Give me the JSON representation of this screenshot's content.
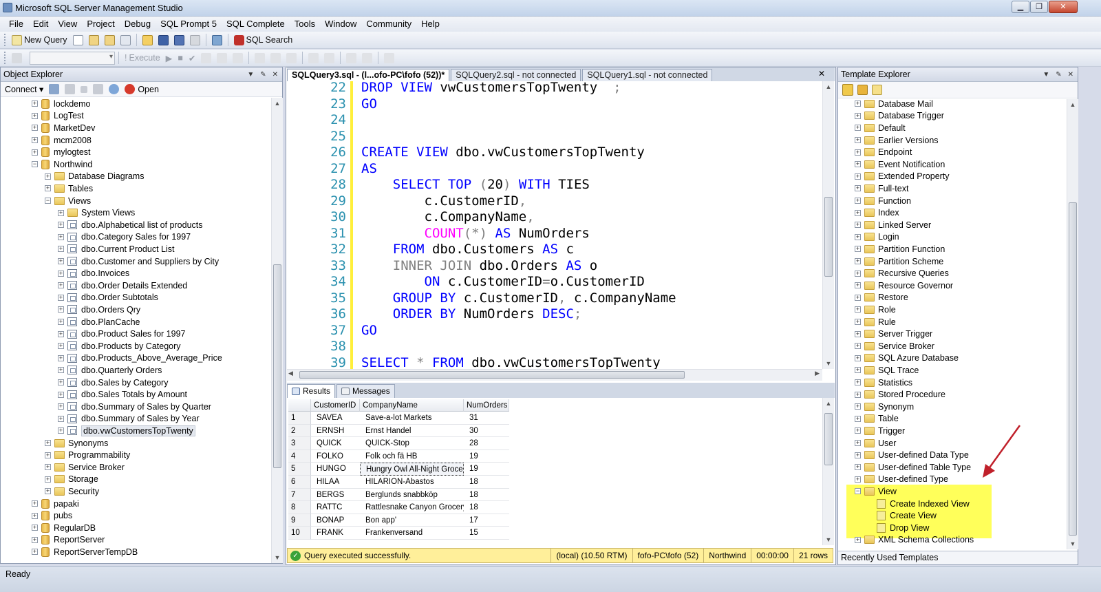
{
  "app": {
    "title": "Microsoft SQL Server Management Studio",
    "status": "Ready"
  },
  "colors": {
    "keyword": "#0000ff",
    "gray_keyword": "#808080",
    "function": "#ff00ff",
    "line_number": "#2b91af",
    "highlight": "#ffff5a",
    "status_bar": "#ffef9a",
    "arrow": "#c0202a"
  },
  "menu": [
    "File",
    "Edit",
    "View",
    "Project",
    "Debug",
    "SQL Prompt 5",
    "SQL Complete",
    "Tools",
    "Window",
    "Community",
    "Help"
  ],
  "toolbar": {
    "new_query": "New Query",
    "sql_search": "SQL Search",
    "execute": "Execute"
  },
  "object_explorer": {
    "title": "Object Explorer",
    "connect": "Connect",
    "open": "Open",
    "nodes": [
      {
        "level": 0,
        "kind": "db",
        "expanded": false,
        "label": "lockdemo"
      },
      {
        "level": 0,
        "kind": "db",
        "expanded": false,
        "label": "LogTest"
      },
      {
        "level": 0,
        "kind": "db",
        "expanded": false,
        "label": "MarketDev"
      },
      {
        "level": 0,
        "kind": "db",
        "expanded": false,
        "label": "mcm2008"
      },
      {
        "level": 0,
        "kind": "db",
        "expanded": false,
        "label": "mylogtest"
      },
      {
        "level": 0,
        "kind": "db",
        "expanded": true,
        "label": "Northwind"
      },
      {
        "level": 1,
        "kind": "folder",
        "expanded": false,
        "label": "Database Diagrams"
      },
      {
        "level": 1,
        "kind": "folder",
        "expanded": false,
        "label": "Tables"
      },
      {
        "level": 1,
        "kind": "folder",
        "expanded": true,
        "label": "Views"
      },
      {
        "level": 2,
        "kind": "folder",
        "expanded": false,
        "label": "System Views"
      },
      {
        "level": 2,
        "kind": "view",
        "expanded": false,
        "label": "dbo.Alphabetical list of products"
      },
      {
        "level": 2,
        "kind": "view",
        "expanded": false,
        "label": "dbo.Category Sales for 1997"
      },
      {
        "level": 2,
        "kind": "view",
        "expanded": false,
        "label": "dbo.Current Product List"
      },
      {
        "level": 2,
        "kind": "view",
        "expanded": false,
        "label": "dbo.Customer and Suppliers by City"
      },
      {
        "level": 2,
        "kind": "view",
        "expanded": false,
        "label": "dbo.Invoices"
      },
      {
        "level": 2,
        "kind": "view",
        "expanded": false,
        "label": "dbo.Order Details Extended"
      },
      {
        "level": 2,
        "kind": "view",
        "expanded": false,
        "label": "dbo.Order Subtotals"
      },
      {
        "level": 2,
        "kind": "view",
        "expanded": false,
        "label": "dbo.Orders Qry"
      },
      {
        "level": 2,
        "kind": "view",
        "expanded": false,
        "label": "dbo.PlanCache"
      },
      {
        "level": 2,
        "kind": "view",
        "expanded": false,
        "label": "dbo.Product Sales for 1997"
      },
      {
        "level": 2,
        "kind": "view",
        "expanded": false,
        "label": "dbo.Products by Category"
      },
      {
        "level": 2,
        "kind": "view",
        "expanded": false,
        "label": "dbo.Products_Above_Average_Price"
      },
      {
        "level": 2,
        "kind": "view",
        "expanded": false,
        "label": "dbo.Quarterly Orders"
      },
      {
        "level": 2,
        "kind": "view",
        "expanded": false,
        "label": "dbo.Sales by Category"
      },
      {
        "level": 2,
        "kind": "view",
        "expanded": false,
        "label": "dbo.Sales Totals by Amount"
      },
      {
        "level": 2,
        "kind": "view",
        "expanded": false,
        "label": "dbo.Summary of Sales by Quarter"
      },
      {
        "level": 2,
        "kind": "view",
        "expanded": false,
        "label": "dbo.Summary of Sales by Year"
      },
      {
        "level": 2,
        "kind": "view",
        "expanded": false,
        "label": "dbo.vwCustomersTopTwenty",
        "selected": true
      },
      {
        "level": 1,
        "kind": "folder",
        "expanded": false,
        "label": "Synonyms"
      },
      {
        "level": 1,
        "kind": "folder",
        "expanded": false,
        "label": "Programmability"
      },
      {
        "level": 1,
        "kind": "folder",
        "expanded": false,
        "label": "Service Broker"
      },
      {
        "level": 1,
        "kind": "folder",
        "expanded": false,
        "label": "Storage"
      },
      {
        "level": 1,
        "kind": "folder",
        "expanded": false,
        "label": "Security"
      },
      {
        "level": 0,
        "kind": "db",
        "expanded": false,
        "label": "papaki"
      },
      {
        "level": 0,
        "kind": "db",
        "expanded": false,
        "label": "pubs"
      },
      {
        "level": 0,
        "kind": "db",
        "expanded": false,
        "label": "RegularDB"
      },
      {
        "level": 0,
        "kind": "db",
        "expanded": false,
        "label": "ReportServer"
      },
      {
        "level": 0,
        "kind": "db",
        "expanded": false,
        "label": "ReportServerTempDB"
      }
    ]
  },
  "editor": {
    "tabs": [
      {
        "label": "SQLQuery3.sql - (l...ofo-PC\\fofo (52))*",
        "active": true
      },
      {
        "label": "SQLQuery2.sql - not connected",
        "active": false
      },
      {
        "label": "SQLQuery1.sql - not connected",
        "active": false
      }
    ],
    "lines": [
      {
        "n": "22",
        "tokens": [
          {
            "t": "DROP",
            "c": "k"
          },
          {
            "t": " "
          },
          {
            "t": "VIEW",
            "c": "k"
          },
          {
            "t": " vwCustomersTopTwenty  "
          },
          {
            "t": ";",
            "c": "g"
          }
        ]
      },
      {
        "n": "23",
        "tokens": [
          {
            "t": "GO",
            "c": "k"
          }
        ]
      },
      {
        "n": "24",
        "tokens": []
      },
      {
        "n": "25",
        "tokens": []
      },
      {
        "n": "26",
        "tokens": [
          {
            "t": "CREATE",
            "c": "k"
          },
          {
            "t": " "
          },
          {
            "t": "VIEW",
            "c": "k"
          },
          {
            "t": " dbo.vwCustomersTopTwenty"
          }
        ]
      },
      {
        "n": "27",
        "tokens": [
          {
            "t": "AS",
            "c": "k"
          }
        ]
      },
      {
        "n": "28",
        "tokens": [
          {
            "t": "    "
          },
          {
            "t": "SELECT",
            "c": "k"
          },
          {
            "t": " "
          },
          {
            "t": "TOP",
            "c": "k"
          },
          {
            "t": " "
          },
          {
            "t": "(",
            "c": "g"
          },
          {
            "t": "20"
          },
          {
            "t": ")",
            "c": "g"
          },
          {
            "t": " "
          },
          {
            "t": "WITH",
            "c": "k"
          },
          {
            "t": " TIES"
          }
        ]
      },
      {
        "n": "29",
        "tokens": [
          {
            "t": "        c.CustomerID"
          },
          {
            "t": ",",
            "c": "g"
          }
        ]
      },
      {
        "n": "30",
        "tokens": [
          {
            "t": "        c.CompanyName"
          },
          {
            "t": ",",
            "c": "g"
          }
        ]
      },
      {
        "n": "31",
        "tokens": [
          {
            "t": "        "
          },
          {
            "t": "COUNT",
            "c": "f"
          },
          {
            "t": "(*)",
            "c": "g"
          },
          {
            "t": " "
          },
          {
            "t": "AS",
            "c": "k"
          },
          {
            "t": " NumOrders"
          }
        ]
      },
      {
        "n": "32",
        "tokens": [
          {
            "t": "    "
          },
          {
            "t": "FROM",
            "c": "k"
          },
          {
            "t": " dbo.Customers "
          },
          {
            "t": "AS",
            "c": "k"
          },
          {
            "t": " c"
          }
        ]
      },
      {
        "n": "33",
        "tokens": [
          {
            "t": "    "
          },
          {
            "t": "INNER JOIN",
            "c": "g"
          },
          {
            "t": " dbo.Orders "
          },
          {
            "t": "AS",
            "c": "k"
          },
          {
            "t": " o"
          }
        ]
      },
      {
        "n": "34",
        "tokens": [
          {
            "t": "        "
          },
          {
            "t": "ON",
            "c": "k"
          },
          {
            "t": " c.CustomerID"
          },
          {
            "t": "=",
            "c": "g"
          },
          {
            "t": "o.CustomerID"
          }
        ]
      },
      {
        "n": "35",
        "tokens": [
          {
            "t": "    "
          },
          {
            "t": "GROUP BY",
            "c": "k"
          },
          {
            "t": " c.CustomerID"
          },
          {
            "t": ",",
            "c": "g"
          },
          {
            "t": " c.CompanyName"
          }
        ]
      },
      {
        "n": "36",
        "tokens": [
          {
            "t": "    "
          },
          {
            "t": "ORDER BY",
            "c": "k"
          },
          {
            "t": " NumOrders "
          },
          {
            "t": "DESC",
            "c": "k"
          },
          {
            "t": ";",
            "c": "g"
          }
        ]
      },
      {
        "n": "37",
        "tokens": [
          {
            "t": "GO",
            "c": "k"
          }
        ]
      },
      {
        "n": "38",
        "tokens": []
      },
      {
        "n": "39",
        "tokens": [
          {
            "t": "SELECT",
            "c": "k"
          },
          {
            "t": " "
          },
          {
            "t": "*",
            "c": "g"
          },
          {
            "t": " "
          },
          {
            "t": "FROM",
            "c": "k"
          },
          {
            "t": " dbo.vwCustomersTopTwenty"
          }
        ]
      }
    ]
  },
  "results": {
    "tabs": {
      "results": "Results",
      "messages": "Messages"
    },
    "columns": [
      "CustomerID",
      "CompanyName",
      "NumOrders"
    ],
    "rows": [
      [
        "1",
        "SAVEA",
        "Save-a-lot Markets",
        "31"
      ],
      [
        "2",
        "ERNSH",
        "Ernst Handel",
        "30"
      ],
      [
        "3",
        "QUICK",
        "QUICK-Stop",
        "28"
      ],
      [
        "4",
        "FOLKO",
        "Folk och fä HB",
        "19"
      ],
      [
        "5",
        "HUNGO",
        "Hungry Owl All-Night Grocers",
        "19"
      ],
      [
        "6",
        "HILAA",
        "HILARION-Abastos",
        "18"
      ],
      [
        "7",
        "BERGS",
        "Berglunds snabbköp",
        "18"
      ],
      [
        "8",
        "RATTC",
        "Rattlesnake Canyon Grocery",
        "18"
      ],
      [
        "9",
        "BONAP",
        "Bon app'",
        "17"
      ],
      [
        "10",
        "FRANK",
        "Frankenversand",
        "15"
      ]
    ]
  },
  "query_status": {
    "message": "Query executed successfully.",
    "server": "(local) (10.50 RTM)",
    "login": "fofo-PC\\fofo (52)",
    "database": "Northwind",
    "elapsed": "00:00:00",
    "rows": "21 rows"
  },
  "template_explorer": {
    "title": "Template Explorer",
    "footer": "Recently Used Templates",
    "items": [
      {
        "level": 0,
        "kind": "folder",
        "expanded": false,
        "label": "Database Mail"
      },
      {
        "level": 0,
        "kind": "folder",
        "expanded": false,
        "label": "Database Trigger"
      },
      {
        "level": 0,
        "kind": "folder",
        "expanded": false,
        "label": "Default"
      },
      {
        "level": 0,
        "kind": "folder",
        "expanded": false,
        "label": "Earlier Versions"
      },
      {
        "level": 0,
        "kind": "folder",
        "expanded": false,
        "label": "Endpoint"
      },
      {
        "level": 0,
        "kind": "folder",
        "expanded": false,
        "label": "Event Notification"
      },
      {
        "level": 0,
        "kind": "folder",
        "expanded": false,
        "label": "Extended Property"
      },
      {
        "level": 0,
        "kind": "folder",
        "expanded": false,
        "label": "Full-text"
      },
      {
        "level": 0,
        "kind": "folder",
        "expanded": false,
        "label": "Function"
      },
      {
        "level": 0,
        "kind": "folder",
        "expanded": false,
        "label": "Index"
      },
      {
        "level": 0,
        "kind": "folder",
        "expanded": false,
        "label": "Linked Server"
      },
      {
        "level": 0,
        "kind": "folder",
        "expanded": false,
        "label": "Login"
      },
      {
        "level": 0,
        "kind": "folder",
        "expanded": false,
        "label": "Partition Function"
      },
      {
        "level": 0,
        "kind": "folder",
        "expanded": false,
        "label": "Partition Scheme"
      },
      {
        "level": 0,
        "kind": "folder",
        "expanded": false,
        "label": "Recursive Queries"
      },
      {
        "level": 0,
        "kind": "folder",
        "expanded": false,
        "label": "Resource Governor"
      },
      {
        "level": 0,
        "kind": "folder",
        "expanded": false,
        "label": "Restore"
      },
      {
        "level": 0,
        "kind": "folder",
        "expanded": false,
        "label": "Role"
      },
      {
        "level": 0,
        "kind": "folder",
        "expanded": false,
        "label": "Rule"
      },
      {
        "level": 0,
        "kind": "folder",
        "expanded": false,
        "label": "Server Trigger"
      },
      {
        "level": 0,
        "kind": "folder",
        "expanded": false,
        "label": "Service Broker"
      },
      {
        "level": 0,
        "kind": "folder",
        "expanded": false,
        "label": "SQL Azure Database"
      },
      {
        "level": 0,
        "kind": "folder",
        "expanded": false,
        "label": "SQL Trace"
      },
      {
        "level": 0,
        "kind": "folder",
        "expanded": false,
        "label": "Statistics"
      },
      {
        "level": 0,
        "kind": "folder",
        "expanded": false,
        "label": "Stored Procedure"
      },
      {
        "level": 0,
        "kind": "folder",
        "expanded": false,
        "label": "Synonym"
      },
      {
        "level": 0,
        "kind": "folder",
        "expanded": false,
        "label": "Table"
      },
      {
        "level": 0,
        "kind": "folder",
        "expanded": false,
        "label": "Trigger"
      },
      {
        "level": 0,
        "kind": "folder",
        "expanded": false,
        "label": "User"
      },
      {
        "level": 0,
        "kind": "folder",
        "expanded": false,
        "label": "User-defined Data Type"
      },
      {
        "level": 0,
        "kind": "folder",
        "expanded": false,
        "label": "User-defined Table Type"
      },
      {
        "level": 0,
        "kind": "folder",
        "expanded": false,
        "label": "User-defined Type"
      },
      {
        "level": 0,
        "kind": "folder",
        "expanded": true,
        "label": "View"
      },
      {
        "level": 1,
        "kind": "template",
        "expanded": false,
        "label": "Create Indexed View"
      },
      {
        "level": 1,
        "kind": "template",
        "expanded": false,
        "label": "Create View"
      },
      {
        "level": 1,
        "kind": "template",
        "expanded": false,
        "label": "Drop View"
      },
      {
        "level": 0,
        "kind": "folder",
        "expanded": false,
        "label": "XML Schema Collections"
      }
    ]
  }
}
